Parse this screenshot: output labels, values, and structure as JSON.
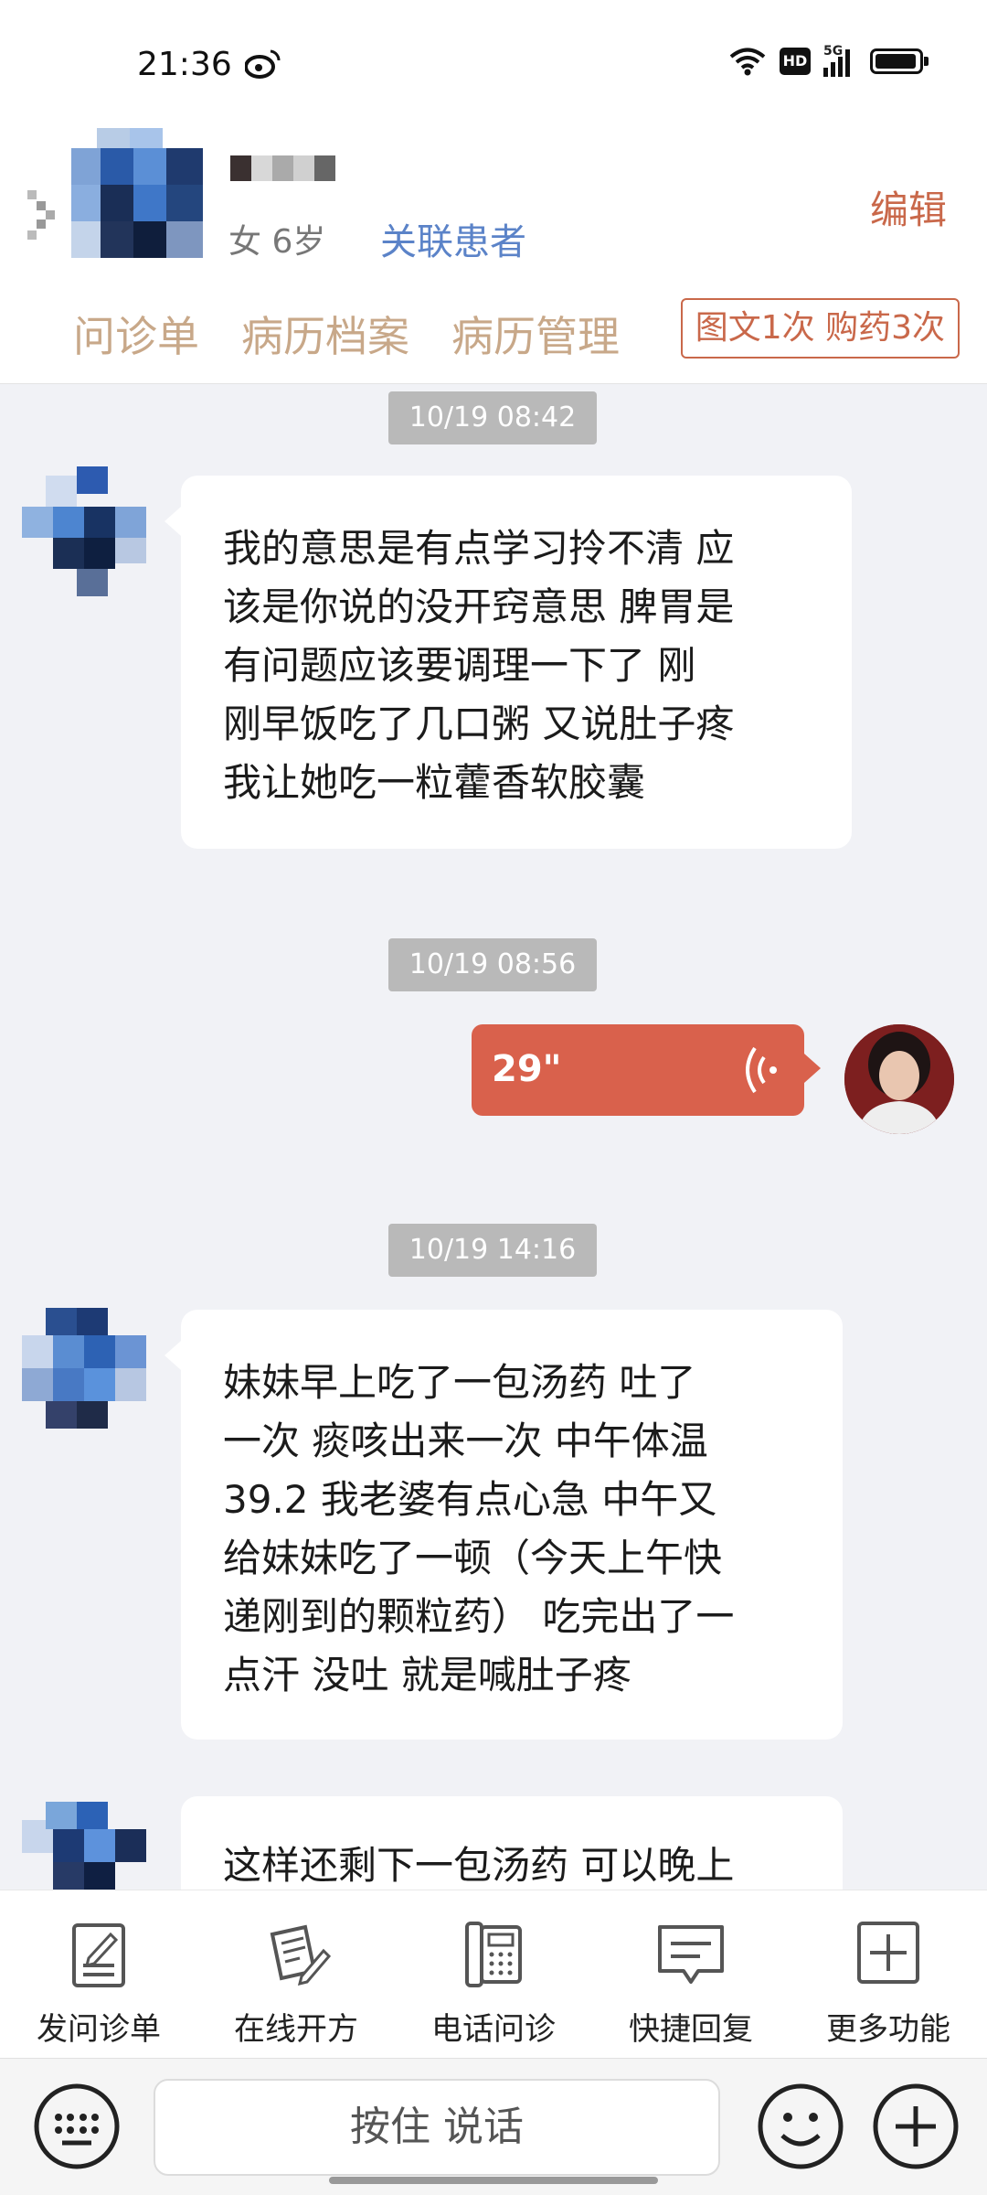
{
  "status_bar": {
    "time": "21:36",
    "icons": [
      "weibo-icon",
      "wifi-icon",
      "hd-icon",
      "5g-signal-icon",
      "battery-icon"
    ],
    "network": "5G",
    "hd": "HD"
  },
  "header": {
    "patient_info": "女 6岁",
    "link_patient": "关联患者",
    "edit": "编辑",
    "tabs": [
      "问诊单",
      "病历档案",
      "病历管理"
    ],
    "badge": "图文1次 购药3次"
  },
  "messages": [
    {
      "timestamp": "10/19 08:42",
      "text": "我的意思是有点学习拎不清 应\n该是你说的没开窍意思 脾胃是\n有问题应该要调理一下了  刚\n刚早饭吃了几口粥 又说肚子疼\n我让她吃一粒藿香软胶囊"
    },
    {
      "timestamp": "10/19 08:56",
      "voice_duration": "29\""
    },
    {
      "timestamp": "10/19 14:16",
      "text": "妹妹早上吃了一包汤药 吐了\n一次 痰咳出来一次 中午体温\n39.2  我老婆有点心急 中午又\n给妹妹吃了一顿（今天上午快\n递刚到的颗粒药） 吃完出了一\n点汗 没吐 就是喊肚子疼"
    },
    {
      "text": "这样还剩下一包汤药 可以晚上"
    }
  ],
  "toolbar": {
    "items": [
      {
        "label": "发问诊单",
        "icon": "inquiry-form-icon"
      },
      {
        "label": "在线开方",
        "icon": "prescription-icon"
      },
      {
        "label": "电话问诊",
        "icon": "phone-icon"
      },
      {
        "label": "快捷回复",
        "icon": "quick-reply-icon"
      },
      {
        "label": "更多功能",
        "icon": "more-icon"
      }
    ]
  },
  "input_bar": {
    "hold_to_talk": "按住 说话"
  },
  "colors": {
    "accent": "#c9684a",
    "link": "#5b83c8",
    "voice_bubble": "#d9614c",
    "tab_text": "#c8a889",
    "background": "#f1f2f6"
  }
}
